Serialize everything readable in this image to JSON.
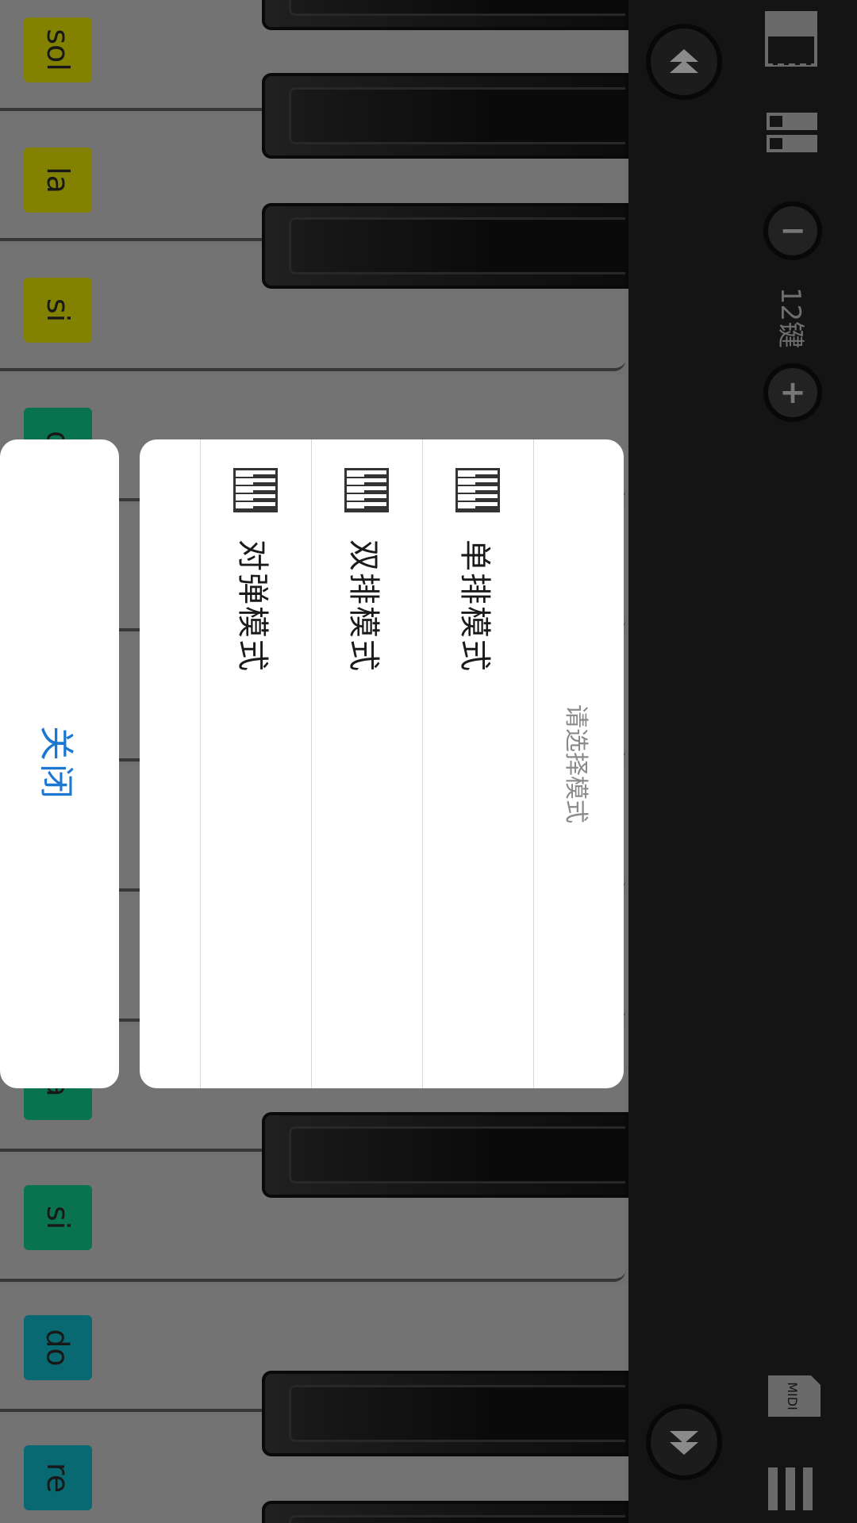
{
  "dialog": {
    "title": "请选择模式",
    "options": [
      {
        "label": "单排模式",
        "icon": "single-row-keyboard-icon"
      },
      {
        "label": "双排模式",
        "icon": "double-row-keyboard-icon"
      },
      {
        "label": "对弹模式",
        "icon": "duet-keyboard-icon"
      }
    ],
    "close_label": "关闭"
  },
  "controls": {
    "key_count": "12键",
    "minus_label": "−",
    "plus_label": "+",
    "midi_label": "MIDI"
  },
  "keyboard": {
    "notes_top": [
      {
        "label": "sol",
        "color": "#8a8a00"
      },
      {
        "label": "la",
        "color": "#8a8a00"
      },
      {
        "label": "si",
        "color": "#8a8a00"
      },
      {
        "label": "d",
        "color": "#0a7a55"
      }
    ],
    "notes_bottom": [
      {
        "label": "a",
        "color": "#0a7a55"
      },
      {
        "label": "si",
        "color": "#0a7a55"
      },
      {
        "label": "do",
        "color": "#0a6f7a"
      },
      {
        "label": "re",
        "color": "#0a6f7a"
      }
    ]
  },
  "colors": {
    "accent": "#1a78d2",
    "panel_bg": "#141414"
  }
}
